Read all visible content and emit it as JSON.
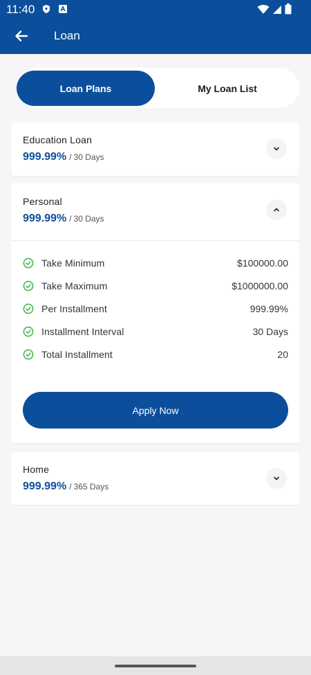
{
  "status_bar": {
    "time": "11:40"
  },
  "app_bar": {
    "title": "Loan"
  },
  "tabs": [
    {
      "label": "Loan Plans",
      "active": true
    },
    {
      "label": "My Loan List",
      "active": false
    }
  ],
  "plans": [
    {
      "name": "Education Loan",
      "rate": "999.99%",
      "separator": "/",
      "period": "30 Days",
      "expanded": false
    },
    {
      "name": "Personal",
      "rate": "999.99%",
      "separator": "/",
      "period": "30 Days",
      "expanded": true,
      "details": [
        {
          "label": "Take Minimum",
          "value": "$100000.00"
        },
        {
          "label": "Take Maximum",
          "value": "$1000000.00"
        },
        {
          "label": "Per Installment",
          "value": "999.99%"
        },
        {
          "label": "Installment Interval",
          "value": "30 Days"
        },
        {
          "label": "Total Installment",
          "value": "20"
        }
      ],
      "action_label": "Apply Now"
    },
    {
      "name": "Home",
      "rate": "999.99%",
      "separator": "/",
      "period": "365 Days",
      "expanded": false
    }
  ],
  "colors": {
    "primary": "#0b4f9c",
    "check": "#3cb44a",
    "background": "#f6f6f7"
  }
}
